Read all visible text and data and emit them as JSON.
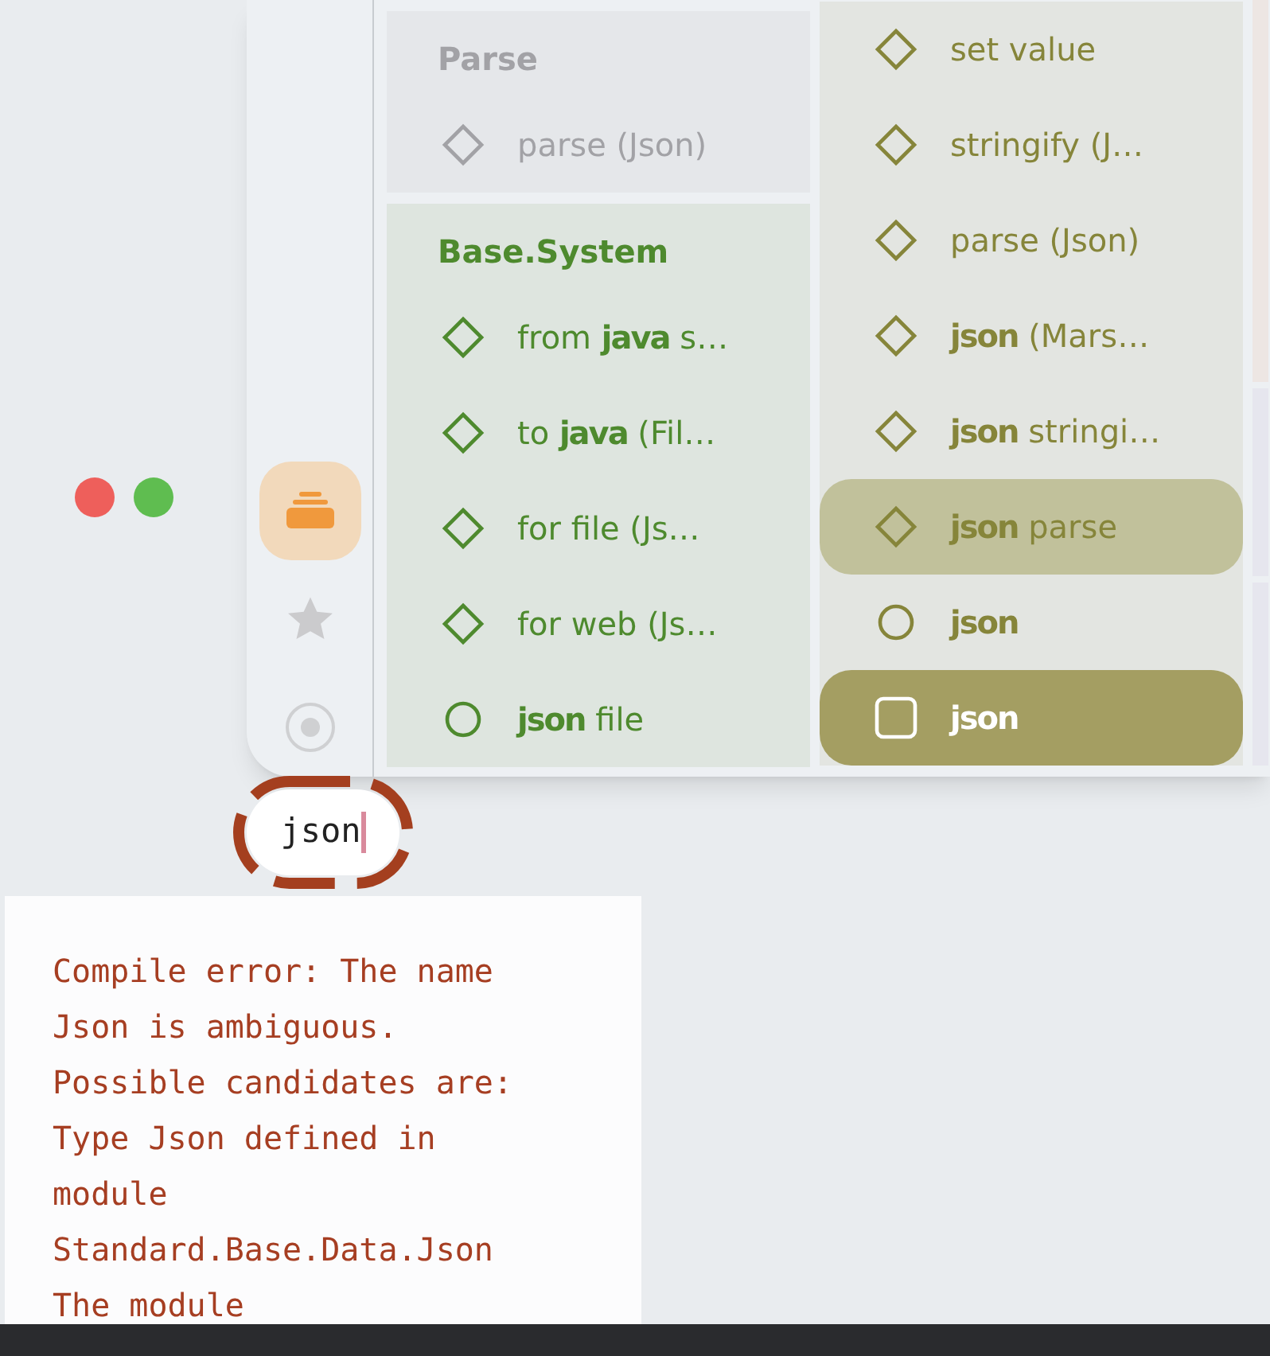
{
  "window_controls": [
    {
      "color": "#ee5f5b"
    },
    {
      "color": "#5fbd50"
    }
  ],
  "sidebar": {
    "items": [
      {
        "kind": "stack",
        "selected": true
      },
      {
        "kind": "star",
        "selected": false
      },
      {
        "kind": "target",
        "selected": false
      }
    ]
  },
  "columns": [
    {
      "groups": [
        {
          "title": "Parse",
          "color": "#a2a2a6",
          "items": [
            {
              "kind": "diamond",
              "label": "parse (Json)",
              "hovered": false,
              "selected": false
            }
          ]
        },
        {
          "title": "Base.System",
          "color": "#4e8a2e",
          "items": [
            {
              "kind": "diamond",
              "label": "from **java** s…",
              "hovered": false,
              "selected": false
            },
            {
              "kind": "diamond",
              "label": "to **java** (Fil…",
              "hovered": false,
              "selected": false
            },
            {
              "kind": "diamond",
              "label": "for file (Js…",
              "hovered": false,
              "selected": false
            },
            {
              "kind": "diamond",
              "label": "for web (Js…",
              "hovered": false,
              "selected": false
            },
            {
              "kind": "circle",
              "label": "**json** file",
              "hovered": false,
              "selected": false
            }
          ]
        }
      ]
    },
    {
      "groups": [
        {
          "color": "#86853a",
          "items": [
            {
              "kind": "diamond",
              "label": "set value",
              "hovered": false,
              "selected": false
            },
            {
              "kind": "diamond",
              "label": "stringify (J…",
              "hovered": false,
              "selected": false
            },
            {
              "kind": "diamond",
              "label": "parse (Json)",
              "hovered": false,
              "selected": false
            },
            {
              "kind": "diamond",
              "label": "**json** (Mars…",
              "hovered": false,
              "selected": false
            },
            {
              "kind": "diamond",
              "label": "**json** stringi…",
              "hovered": false,
              "selected": false
            },
            {
              "kind": "diamond",
              "label": "**json** parse",
              "hovered": true,
              "selected": false
            },
            {
              "kind": "circle",
              "label": "**json**",
              "hovered": false,
              "selected": false
            },
            {
              "kind": "square",
              "label": "**json**",
              "hovered": false,
              "selected": true
            }
          ]
        }
      ]
    }
  ],
  "input": {
    "value": "json"
  },
  "error": {
    "lines": [
      "Compile error: The name",
      "Json is ambiguous.",
      "Possible candidates are:",
      "Type Json defined in",
      "module",
      "Standard.Base.Data.Json",
      "The module"
    ]
  }
}
